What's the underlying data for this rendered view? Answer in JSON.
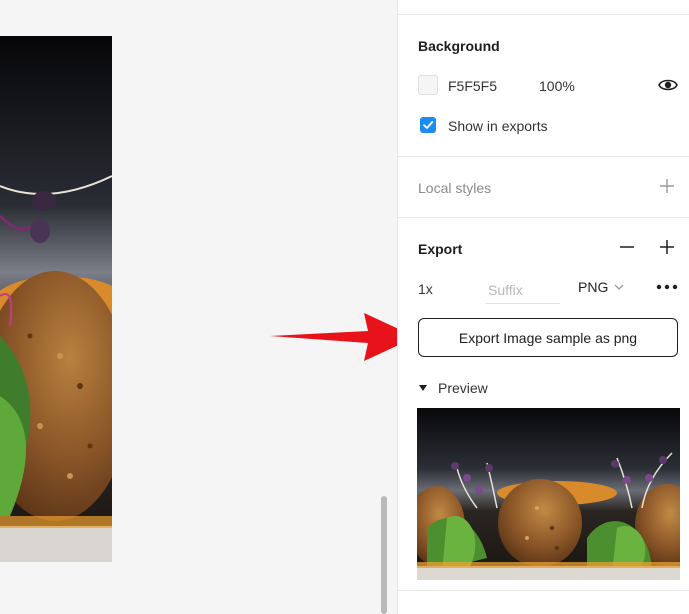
{
  "background": {
    "title": "Background",
    "color_hex": "F5F5F5",
    "opacity": "100%",
    "show_in_exports_label": "Show in exports",
    "show_in_exports_checked": true
  },
  "local_styles": {
    "title": "Local styles"
  },
  "export": {
    "title": "Export",
    "scale": "1x",
    "suffix_placeholder": "Suffix",
    "suffix_value": "",
    "format": "PNG",
    "button_label": "Export Image sample as png",
    "preview_label": "Preview"
  },
  "colors": {
    "accent": "#1b8cf2",
    "arrow": "#e8121a",
    "canvas_bg": "#f5f5f5"
  },
  "icons": {
    "visibility": "eye-icon",
    "add": "plus-icon",
    "remove": "minus-icon",
    "more": "ellipsis-icon",
    "dropdown": "chevron-down-icon",
    "preview_toggle": "caret-down-icon"
  }
}
